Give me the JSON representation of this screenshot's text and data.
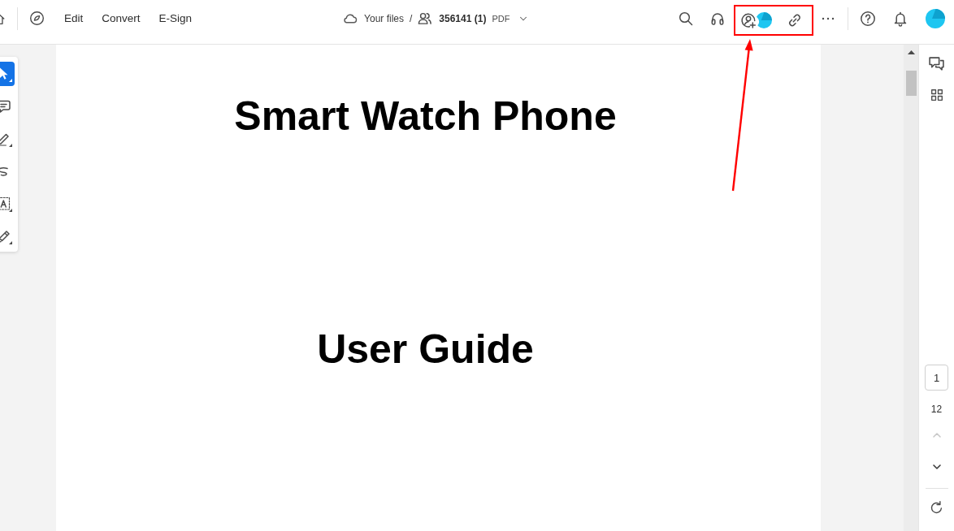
{
  "top_bar": {
    "menu": [
      {
        "label": "Edit"
      },
      {
        "label": "Convert"
      },
      {
        "label": "E-Sign"
      }
    ],
    "breadcrumb": {
      "location": "Your files",
      "separator": "/",
      "file_name": "356141 (1)",
      "file_type": "PDF"
    }
  },
  "tools": [
    {
      "kind": "select",
      "selected": true
    },
    {
      "kind": "comment",
      "selected": false
    },
    {
      "kind": "pencil",
      "selected": false
    },
    {
      "kind": "freehand",
      "selected": false
    },
    {
      "kind": "text-select",
      "selected": false
    },
    {
      "kind": "sign",
      "selected": false
    }
  ],
  "document": {
    "title": "Smart Watch Phone",
    "subtitle": "User Guide"
  },
  "page_nav": {
    "current_page": "1",
    "total_pages": "12",
    "previous_disabled": true,
    "next_disabled": false
  },
  "annotations": {
    "highlight_box": true,
    "arrow": true
  }
}
